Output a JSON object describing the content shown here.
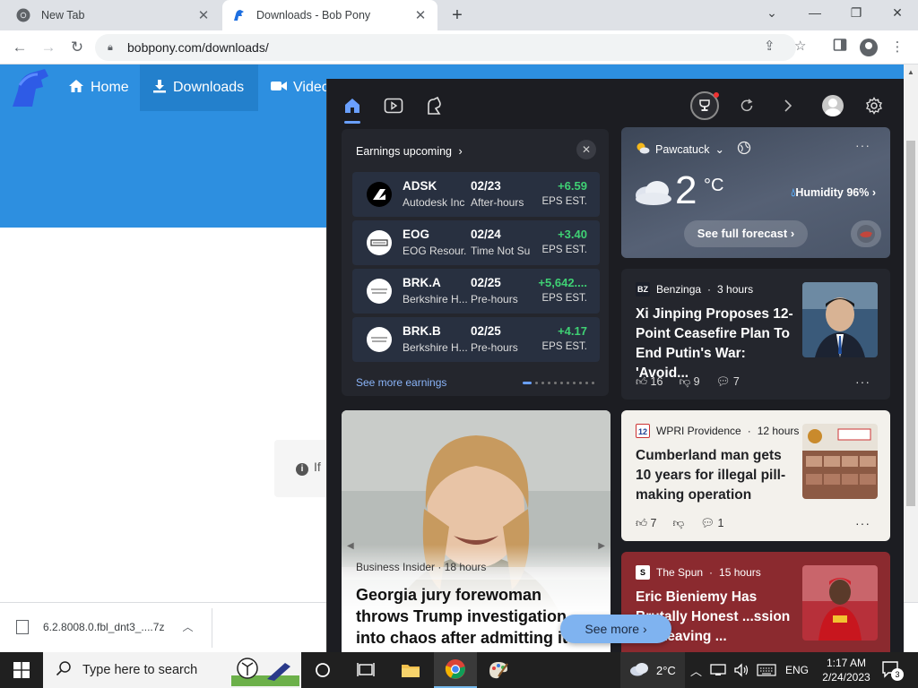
{
  "browser": {
    "tabs": [
      {
        "title": "New Tab",
        "active": false
      },
      {
        "title": "Downloads - Bob Pony",
        "active": true
      }
    ],
    "url": "bobpony.com/downloads/"
  },
  "site": {
    "nav": [
      {
        "label": "Home",
        "icon": "home-icon"
      },
      {
        "label": "Downloads",
        "icon": "download-icon"
      },
      {
        "label": "Videc",
        "icon": "video-icon"
      }
    ],
    "info_text": "If"
  },
  "download_shelf": {
    "file_name": "6.2.8008.0.fbl_dnt3_....7z"
  },
  "widgets": {
    "earnings": {
      "title": "Earnings upcoming",
      "see_more": "See more earnings",
      "rows": [
        {
          "symbol": "ADSK",
          "name": "Autodesk Inc",
          "date": "02/23",
          "time": "After-hours",
          "value": "+6.59",
          "label": "EPS EST."
        },
        {
          "symbol": "EOG",
          "name": "EOG Resour...",
          "date": "02/24",
          "time": "Time Not Su",
          "value": "+3.40",
          "label": "EPS EST."
        },
        {
          "symbol": "BRK.A",
          "name": "Berkshire H...",
          "date": "02/25",
          "time": "Pre-hours",
          "value": "+5,642....",
          "label": "EPS EST."
        },
        {
          "symbol": "BRK.B",
          "name": "Berkshire H...",
          "date": "02/25",
          "time": "Pre-hours",
          "value": "+4.17",
          "label": "EPS EST."
        }
      ]
    },
    "weather": {
      "location": "Pawcatuck",
      "temperature": "2",
      "unit": "°C",
      "humidity": "Humidity 96%",
      "forecast": "See full forecast"
    },
    "news": [
      {
        "source": "Benzinga",
        "time": "3 hours",
        "title": "Xi Jinping Proposes 12-Point Ceasefire Plan To End Putin's War: 'Avoid...",
        "likes": "16",
        "dislikes": "9",
        "comments": "7"
      },
      {
        "source": "WPRI Providence",
        "time": "12 hours",
        "title": "Cumberland man gets 10 years for illegal pill-making operation",
        "likes": "7",
        "dislikes": "",
        "comments": "1"
      },
      {
        "source": "The Spun",
        "time": "15 hours",
        "title": "Eric Bieniemy Has Brutally Honest ...ssion On Leaving ..."
      }
    ],
    "featured": {
      "source": "Business Insider",
      "time": "18 hours",
      "title": "Georgia jury forewoman throws Trump investigation into chaos after admitting it would have..."
    },
    "see_more": "See more"
  },
  "taskbar": {
    "search_placeholder": "Type here to search",
    "weather_temp": "2°C",
    "language": "ENG",
    "time": "1:17 AM",
    "date": "2/24/2023",
    "notification_count": "3"
  }
}
